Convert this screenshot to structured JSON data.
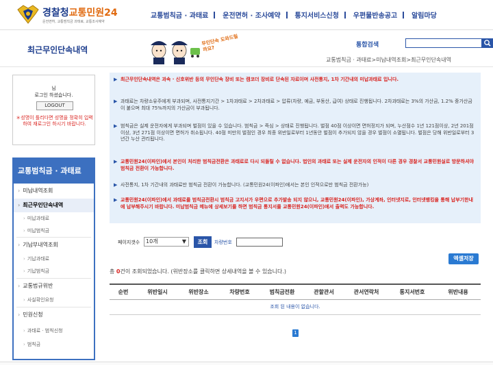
{
  "brand": {
    "name_blue": "경찰청",
    "name_orange": "교통민원24",
    "subtitle": "운전면허, 교통범칙금 과태료, 교통조사예약"
  },
  "topnav": {
    "items": [
      "교통범칙금 · 과태료",
      "운전면허 · 조사예약",
      "통지서비스신청",
      "우편물반송공고",
      "알림마당"
    ]
  },
  "page": {
    "title": "최근무인단속내역",
    "breadcrumb": "교통범칙금 · 과태료>미납내역조회>최근무인단속내역",
    "mascot_text": "무인단속 도와드릴까요?"
  },
  "search": {
    "label": "통합검색",
    "value": ""
  },
  "login": {
    "name": "님",
    "message": "로그인 하셨습니다.",
    "logout_label": "LOGOUT",
    "warning": "＊성명이 틀리다면 성명을 정확히 입력하여 재로그인 하시기 바랍니다."
  },
  "sidebar": {
    "head": "교통범칙금 · 과태료",
    "items": [
      {
        "label": "미납내역조회",
        "level": 1
      },
      {
        "label": "최근무인단속내역",
        "level": 1,
        "active": true
      },
      {
        "label": "미납과태료",
        "level": 2
      },
      {
        "label": "미납범칙금",
        "level": 2
      },
      {
        "label": "기납부내역조회",
        "level": 1
      },
      {
        "label": "기납과태료",
        "level": 2
      },
      {
        "label": "기납범칙금",
        "level": 2
      },
      {
        "label": "교통법규위반",
        "level": 1
      },
      {
        "label": "사실확인요청",
        "level": 2
      },
      {
        "label": "민원신청",
        "level": 1
      },
      {
        "label": "과태료 · 범칙신청",
        "level": 2
      },
      {
        "label": "범칙금",
        "level": 2
      }
    ]
  },
  "notices": [
    {
      "kind": "red",
      "text": "최근무인단속내역은 과속 · 신호위반 등의 무인단속 장비 또는 캠코더 장비로 단속된 자료이며 사전통지, 1차 기간내의 미납과태료 입니다."
    },
    {
      "kind": "gray",
      "text": "과태료는 차량소유주에게 부과되며, 사전통지기간 > 1차과태료 > 2차과태료 > 압류(차량, 예금, 부동산, 급여) 상태로 진행됩니다. 2차과태료는 3%의 가산금, 1.2% 중가산금이 붙으며 최대 75%까지의 가산금이 부과됩니다."
    },
    {
      "kind": "gray",
      "text": "범칙금은 실제 운전자에게 부과되며 벌점이 있을 수 있습니다. 범칙금 > 즉심 > 상태로 진행됩니다. 벌점 40점 이상이면 면허정지가 되며, 누산점수 1년 121점이상, 2년 201점 이상, 3년 271점 이상이면 면허가 취소됩니다. 40점 미만의 벌점인 경우 최종 위반일로부터 1년동안 벌점이 추가되지 않을 경우 벌점이 소멸됩니다. 벌점은 당해 위반일로부터 3년간 누산 관리됩니다."
    },
    {
      "kind": "red",
      "text": "교통민원24(이파인)에서 본인이 처리한 범칙금전환은 과태료로 다시 되돌릴 수 없습니다. 법인의 과태료 또는 실제 운전자의 인적이 다른 경우 경찰서 교통민원실로 방문하셔야 범칙금 전환이 가능합니다."
    },
    {
      "kind": "gray",
      "text": "사전통지, 1차 기간내의 과태료만 범칙금 전환이 가능합니다. (교통민원24(이파인)에서는 본인 인적으로만 범칙금 전환가능)"
    },
    {
      "kind": "red",
      "text": "교통민원24(이파인)에서 과태료를 범칙금전환시 범칙금 고지서가 우편으로 추가발송 되지 않으니, 교통민원24(이파인), 가상계좌, 인터넷지로, 인터넷뱅킹을 통해 납부기한내에 납부해주시기 바랍니다. 미납범칙금 메뉴에 상세보기를 하면 범칙금 통지서를 교통민원24(이파인)에서 출력도 가능합니다."
    }
  ],
  "filter": {
    "per_page_label": "페이지갯수",
    "per_page_value": "10개",
    "query_label": "조회",
    "car_label": "차량번호",
    "car_value": ""
  },
  "excel_label": "엑셀저장",
  "result": {
    "prefix": "총 ",
    "count": "0",
    "suffix": "건이 조회되었습니다. (위반장소를 클릭하면 상세내역을 볼 수 있습니다.)"
  },
  "table": {
    "columns": [
      "순번",
      "위반일시",
      "위반장소",
      "차량번호",
      "범칙금전환",
      "관할관서",
      "관서연락처",
      "통지서번호",
      "위반내용"
    ],
    "empty_message": "조회 된 내용이 없습니다."
  },
  "pager": {
    "current": "1"
  },
  "colors": {
    "primary": "#2a55a8",
    "sidebar": "#3c70c0",
    "alert": "#d9231f",
    "notice_bg": "#e6f0fa"
  }
}
